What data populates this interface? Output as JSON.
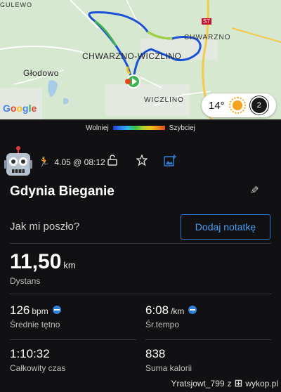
{
  "map": {
    "labels": {
      "gulewo": "GULEWO",
      "chwarzno_wiczlino": "CHWARZNO-WICZLINO",
      "chwarzno": "CHWARZNO",
      "glodowo": "Głodowo",
      "wiczlino": "WICZLINO",
      "road_s7": "S7"
    },
    "google": "Google",
    "weather": {
      "temperature": "14°",
      "icon": "sun-icon",
      "wind": "2"
    }
  },
  "legend": {
    "slow": "Wolniej",
    "fast": "Szybciej"
  },
  "activity": {
    "icon": "run-icon",
    "date": "4.05 @ 08:12",
    "title": "Gdynia Bieganie",
    "note_question": "Jak mi poszło?",
    "note_button": "Dodaj notatkę"
  },
  "stats": {
    "distance": {
      "value": "11,50",
      "unit": "km",
      "label": "Dystans"
    },
    "heart_rate": {
      "value": "126",
      "unit": "bpm",
      "label": "Średnie tętno"
    },
    "pace": {
      "value": "6:08",
      "unit": "/km",
      "label": "Śr.tempo"
    },
    "time": {
      "value": "1:10:32",
      "label": "Całkowity czas"
    },
    "calories": {
      "value": "838",
      "label": "Suma kalorii"
    }
  },
  "watermark": {
    "user": "Yratsjowt_799",
    "sep": "z",
    "site": "wykop.pl"
  },
  "colors": {
    "accent": "#2f7ed8",
    "background": "#111113",
    "route_start": "#3fb34f"
  }
}
